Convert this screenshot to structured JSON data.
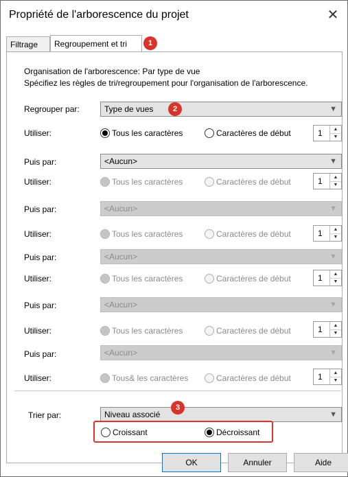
{
  "window": {
    "title": "Propriété de l'arborescence du projet",
    "close_glyph": "✕"
  },
  "tabs": [
    {
      "label": "Filtrage"
    },
    {
      "label": "Regroupement et tri"
    }
  ],
  "badges": [
    "1",
    "2",
    "3"
  ],
  "description": {
    "line1": "Organisation de l'arborescence: Par type de vue",
    "line2": "Spécifiez les règles de tri/regroupement pour l'organisation de l'arborescence."
  },
  "group": {
    "regrouper_label": "Regrouper par:",
    "puis_label": "Puis par:",
    "utiliser_label": "Utiliser:",
    "first_value": "Type de vues",
    "aucun_value": "<Aucun>",
    "tous_label": "Tous les caractères",
    "tous_label_last": "Tous& les caractères",
    "debut_label": "Caractères de début",
    "count": "1"
  },
  "sort": {
    "label": "Trier par:",
    "value": "Niveau associé",
    "asc_label": "Croissant",
    "desc_label": "Décroissant",
    "selected": "desc"
  },
  "buttons": {
    "ok": "OK",
    "cancel": "Annuler",
    "help": "Aide"
  },
  "colors": {
    "badge": "#d9342b",
    "highlight_border": "#d9342b",
    "primary_border": "#0078d7"
  }
}
